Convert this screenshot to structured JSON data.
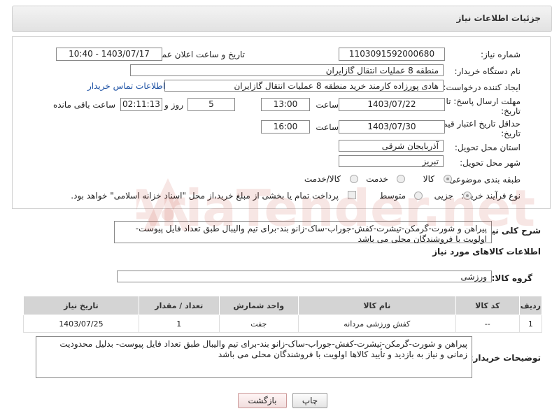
{
  "header": {
    "title": "جزئیات اطلاعات نیاز"
  },
  "form": {
    "need_number_label": "شماره نیاز:",
    "need_number": "1103091592000680",
    "announce_label": "تاریخ و ساعت اعلان عمومی:",
    "announce_value": "1403/07/17 - 10:40",
    "buyer_org_label": "نام دستگاه خریدار:",
    "buyer_org": "منطقه 8 عملیات انتقال گازایران",
    "creator_label": "ایجاد کننده درخواست:",
    "creator": "هادی پورزاده کارمند خرید منطقه 8 عملیات انتقال گازایران",
    "contact_link": "اطلاعات تماس خریدار",
    "deadline_label_1": "مهلت ارسال پاسخ: تا",
    "deadline_label_2": "تاریخ:",
    "deadline_date": "1403/07/22",
    "hour_label": "ساعت",
    "deadline_time": "13:00",
    "days_value": "5",
    "days_label": "روز و",
    "remaining_time": "02:11:13",
    "remaining_label": "ساعت باقی مانده",
    "validity_label_1": "حداقل تاریخ اعتبار قیمت: تا",
    "validity_label_2": "تاریخ:",
    "validity_date": "1403/07/30",
    "validity_time": "16:00",
    "province_label": "استان محل تحویل:",
    "province": "آذربایجان شرقی",
    "city_label": "شهر محل تحویل:",
    "city": "تبریز",
    "category_label": "طبقه بندی موضوعی:",
    "category_options": [
      "کالا",
      "خدمت",
      "کالا/خدمت"
    ],
    "process_label": "نوع فرآیند خرید :",
    "process_options": [
      "جزیی",
      "متوسط"
    ],
    "payment_note": "پرداخت تمام یا بخشی از مبلغ خرید،از محل \"اسناد خزانه اسلامی\" خواهد بود."
  },
  "summary": {
    "label": "شرح کلی نیاز:",
    "text": "پیراهن و شورت-گرمکن-تیشرت-کفش-جوراب-ساک-زانو بند-برای تیم والیبال طبق تعداد فایل پیوست-اولویت با فروشندگان محلی می باشد"
  },
  "goods": {
    "section_title": "اطلاعات کالاهای مورد نیاز",
    "group_label": "گروه کالا:",
    "group_value": "ورزشی",
    "columns": [
      "ردیف",
      "کد کالا",
      "نام کالا",
      "واحد شمارش",
      "تعداد / مقدار",
      "تاریخ نیاز"
    ],
    "rows": [
      [
        "1",
        "--",
        "کفش ورزشی مردانه",
        "جفت",
        "1",
        "1403/07/25"
      ]
    ]
  },
  "buyer_notes": {
    "label": "توضیحات خریدار:",
    "text": "پیراهن و شورت-گرمکن-تیشرت-کفش-جوراب-ساک-زانو بند-برای تیم والیبال طبق تعداد فایل پیوست- بدلیل محدودیت زمانی و نیاز به بازدید و تأیید کالاها اولویت با فروشندگان محلی می باشد"
  },
  "buttons": {
    "print": "چاپ",
    "back": "بازگشت"
  },
  "watermark": {
    "text": "AriaTender.net"
  }
}
